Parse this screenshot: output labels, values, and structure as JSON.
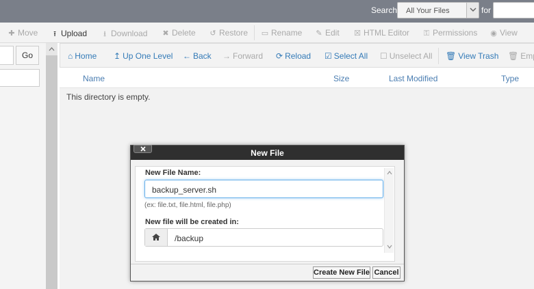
{
  "topbar": {
    "search_label": "Search",
    "search_scope": "All Your Files",
    "for_label": "for",
    "search_value": ""
  },
  "toolbar": {
    "items": [
      {
        "label": "Move",
        "icon": "move-icon"
      },
      {
        "label": "Upload",
        "icon": "upload-icon"
      },
      {
        "label": "Download",
        "icon": "download-icon"
      },
      {
        "label": "Delete",
        "icon": "delete-icon"
      },
      {
        "label": "Restore",
        "icon": "restore-icon"
      },
      {
        "label": "Rename",
        "icon": "rename-icon"
      },
      {
        "label": "Edit",
        "icon": "edit-icon"
      },
      {
        "label": "HTML Editor",
        "icon": "html-editor-icon"
      },
      {
        "label": "Permissions",
        "icon": "key-icon"
      },
      {
        "label": "View",
        "icon": "eye-icon"
      }
    ]
  },
  "leftpane": {
    "go_label": "Go"
  },
  "nav": {
    "items": [
      {
        "label": "Home",
        "icon": "home-icon"
      },
      {
        "label": "Up One Level",
        "icon": "up-level-icon"
      },
      {
        "label": "Back",
        "icon": "back-arrow-icon"
      },
      {
        "label": "Forward",
        "icon": "forward-arrow-icon"
      },
      {
        "label": "Reload",
        "icon": "reload-icon"
      },
      {
        "label": "Select All",
        "icon": "checkbox-checked-icon"
      },
      {
        "label": "Unselect All",
        "icon": "checkbox-empty-icon"
      },
      {
        "label": "View Trash",
        "icon": "trash-icon"
      },
      {
        "label": "Empt",
        "icon": "trash-icon"
      }
    ]
  },
  "columns": [
    "Name",
    "Size",
    "Last Modified",
    "Type"
  ],
  "filelist": {
    "empty_message": "This directory is empty."
  },
  "dialog": {
    "title": "New File",
    "file_name_label": "New File Name:",
    "file_name_value": "backup_server.sh",
    "hint": "(ex: file.txt, file.html, file.php)",
    "location_label": "New file will be created in:",
    "location_value": "/backup",
    "create_button": "Create New File",
    "cancel_button": "Cancel"
  },
  "colors": {
    "topbar_bg": "#7a7f89",
    "link_blue": "#337ab7",
    "disabled_gray": "#a9a9a9",
    "dialog_header": "#2f2f2f"
  }
}
